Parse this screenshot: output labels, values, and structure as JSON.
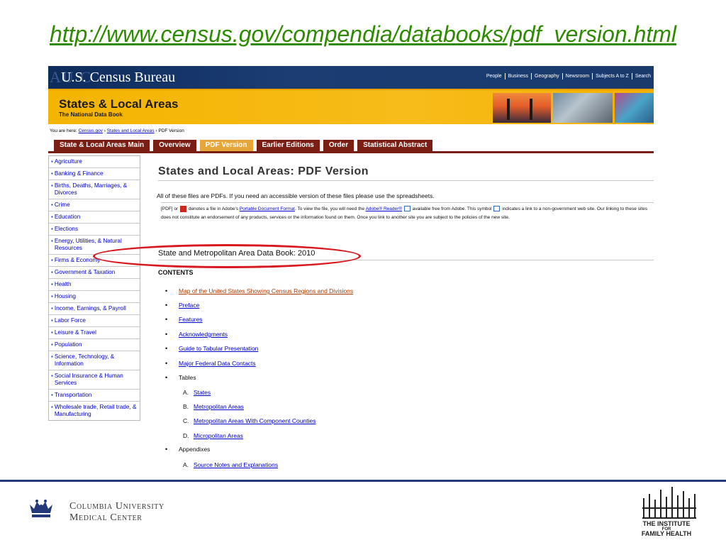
{
  "slide": {
    "url_title": "http://www.census.gov/compendia/databooks/pdf_version.html"
  },
  "census_header": {
    "seal_text": "AU C",
    "title": "U.S. Census Bureau",
    "nav": [
      "People",
      "Business",
      "Geography",
      "Newsroom",
      "Subjects A to Z",
      "Search"
    ]
  },
  "banner": {
    "title": "States & Local Areas",
    "subtitle": "The National Data Book"
  },
  "breadcrumb": {
    "prefix": "You are here:",
    "items": [
      "Census.gov",
      "States and Local Areas"
    ],
    "current": "PDF Version"
  },
  "tabs": [
    {
      "label": "State & Local Areas Main",
      "active": false
    },
    {
      "label": "Overview",
      "active": false
    },
    {
      "label": "PDF Version",
      "active": true
    },
    {
      "label": "Earlier Editions",
      "active": false
    },
    {
      "label": "Order",
      "active": false
    },
    {
      "label": "Statistical Abstract",
      "active": false
    }
  ],
  "sidebar": {
    "items": [
      "Agriculture",
      "Banking & Finance",
      "Births, Deaths, Marriages, & Divorces",
      "Crime",
      "Education",
      "Elections",
      "Energy, Utilities, & Natural Resources",
      "Firms & Economy",
      "Government & Taxation",
      "Health",
      "Housing",
      "Income, Earnings, & Payroll",
      "Labor Force",
      "Leisure & Travel",
      "Population",
      "Science, Technology, & Information",
      "Social Insurance & Human Services",
      "Transportation",
      "Wholesale trade, Retail trade, & Manufacturing"
    ]
  },
  "main": {
    "title": "States and Local Areas: PDF Version",
    "intro": "All of these files are PDFs. If you need an accessible version of these files please use the spreadsheets.",
    "notice": {
      "part1": "[PDF] or",
      "part2": "denotes a file in Adobe's",
      "pdf_link": "Portable Document Format",
      "part3": ". To view the file, you will need the",
      "reader_link": "Adobe® Reader®",
      "part4": "available free from Adobe. This symbol",
      "part5": "indicates a link to a non-government web site. Our linking to these sites does not constitute an endorsement of any products, services or the information found on them. Once you link to another site you are subject to the policies of the new site."
    },
    "section_title": "State and Metropolitan Area Data Book: 2010",
    "contents_label": "CONTENTS",
    "toc": [
      "Map of the United States Showing Census Regions and Divisions",
      "Preface",
      "Features",
      "Acknowledgments",
      "Guide to Tabular Presentation",
      "Major Federal Data Contacts"
    ],
    "tables_label": "Tables",
    "tables": [
      {
        "letter": "A.",
        "label": "States"
      },
      {
        "letter": "B.",
        "label": "Metropolitan Areas"
      },
      {
        "letter": "C.",
        "label": "Metropolitan Areas With Component Counties"
      },
      {
        "letter": "D.",
        "label": "Micropolitan Areas"
      }
    ],
    "appendixes_label": "Appendixes",
    "appendixes": [
      {
        "letter": "A.",
        "label": "Source Notes and Explanations"
      }
    ]
  },
  "footer": {
    "org_line1": "Columbia University",
    "org_line2": "Medical Center",
    "ifh_line1": "THE INSTITUTE",
    "ifh_line2": "FOR",
    "ifh_line3": "FAMILY HEALTH"
  },
  "colors": {
    "slide_link": "#2e8b00",
    "census_nav_bar": "#1b3d73",
    "banner": "#f4b400",
    "tab": "#7a1e14",
    "tab_active": "#e7a63a",
    "annotation_ellipse": "#d8171e",
    "footer_rule": "#23397a"
  }
}
